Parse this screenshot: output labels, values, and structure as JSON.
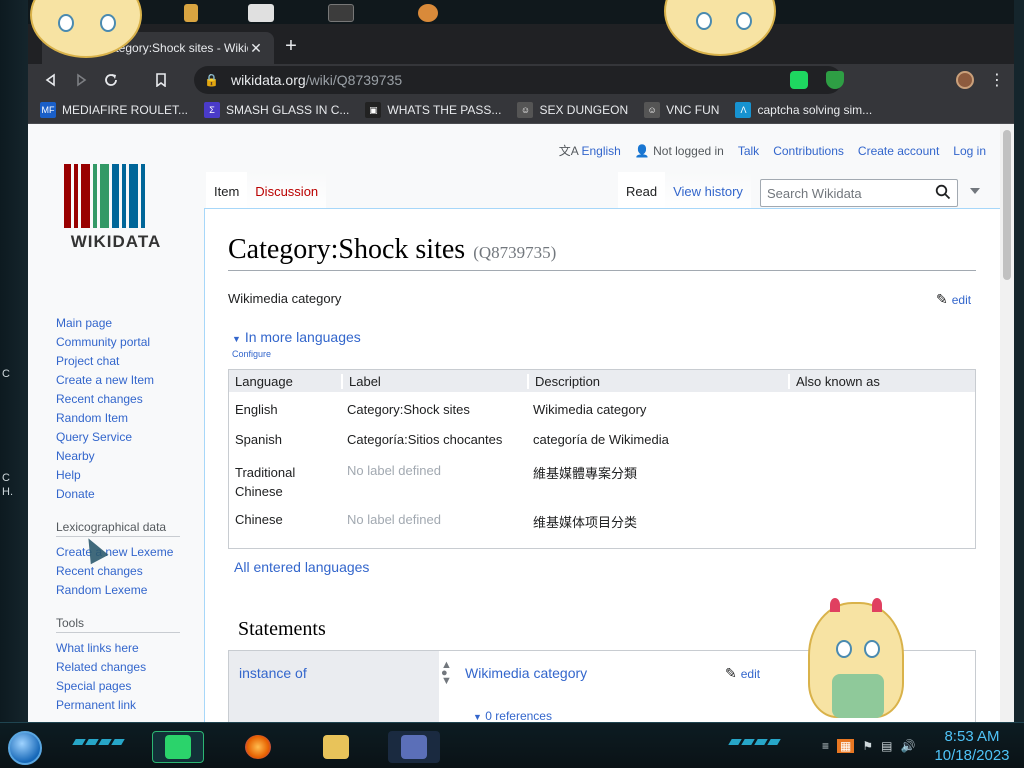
{
  "browser": {
    "tab_title": "Category:Shock sites - Wikidata",
    "tab_close": "✕",
    "new_tab": "+",
    "url_host": "wikidata.org",
    "url_path": "/wiki/Q8739735",
    "bookmarks": [
      {
        "label": "MEDIAFIRE ROULET...",
        "icon": "mf-icon",
        "color": "#1a5fc7",
        "glyph": "MF"
      },
      {
        "label": "SMASH GLASS IN C...",
        "icon": "glass-icon",
        "color": "#4a3bc9",
        "glyph": "Σ"
      },
      {
        "label": "WHATS THE PASS...",
        "icon": "terminal-icon",
        "color": "#222222",
        "glyph": "▣"
      },
      {
        "label": "SEX DUNGEON",
        "icon": "bot-icon",
        "color": "#555555",
        "glyph": "☺"
      },
      {
        "label": "VNC FUN",
        "icon": "bot-icon",
        "color": "#555555",
        "glyph": "☺"
      },
      {
        "label": "captcha solving sim...",
        "icon": "arch-icon",
        "color": "#1793d1",
        "glyph": "Λ"
      }
    ]
  },
  "wiki": {
    "userbar": {
      "language": "English",
      "not_logged": "Not logged in",
      "talk": "Talk",
      "contributions": "Contributions",
      "create_account": "Create account",
      "login": "Log in"
    },
    "logo_word": "WIKIDATA",
    "logo_colors": [
      "#990000",
      "#990000",
      "#990000",
      "#339966",
      "#339966",
      "#006699",
      "#006699",
      "#006699",
      "#006699"
    ],
    "tabs": {
      "item": "Item",
      "discussion": "Discussion",
      "read": "Read",
      "history": "View history"
    },
    "search_placeholder": "Search Wikidata",
    "sidebar": {
      "main": [
        "Main page",
        "Community portal",
        "Project chat",
        "Create a new Item",
        "Recent changes",
        "Random Item",
        "Query Service",
        "Nearby",
        "Help",
        "Donate"
      ],
      "lexico_title": "Lexicographical data",
      "lexico": [
        "Create a new Lexeme",
        "Recent changes",
        "Random Lexeme"
      ],
      "tools_title": "Tools",
      "tools": [
        "What links here",
        "Related changes",
        "Special pages",
        "Permanent link"
      ]
    },
    "title": "Category:Shock sites",
    "qid": "(Q8739735)",
    "description": "Wikimedia category",
    "edit": "edit",
    "more_languages": "In more languages",
    "configure": "Configure",
    "lang_headers": [
      "Language",
      "Label",
      "Description",
      "Also known as"
    ],
    "lang_rows": [
      {
        "lang": "English",
        "label": "Category:Shock sites",
        "desc": "Wikimedia category",
        "aka": "",
        "missing": false
      },
      {
        "lang": "Spanish",
        "label": "Categoría:Sitios chocantes",
        "desc": "categoría de Wikimedia",
        "aka": "",
        "missing": false
      },
      {
        "lang": "Traditional Chinese",
        "label": "No label defined",
        "desc": "維基媒體專案分類",
        "aka": "",
        "missing": true
      },
      {
        "lang": "Chinese",
        "label": "No label defined",
        "desc": "维基媒体项目分类",
        "aka": "",
        "missing": true
      }
    ],
    "all_languages": "All entered languages",
    "statements_title": "Statements",
    "statement": {
      "property": "instance of",
      "value": "Wikimedia category",
      "refs": "0 references"
    }
  },
  "taskbar": {
    "time": "8:53 AM",
    "date": "10/18/2023"
  },
  "desktop": {
    "left_text_1": "C",
    "left_text_2": "C",
    "left_text_3": "H."
  }
}
